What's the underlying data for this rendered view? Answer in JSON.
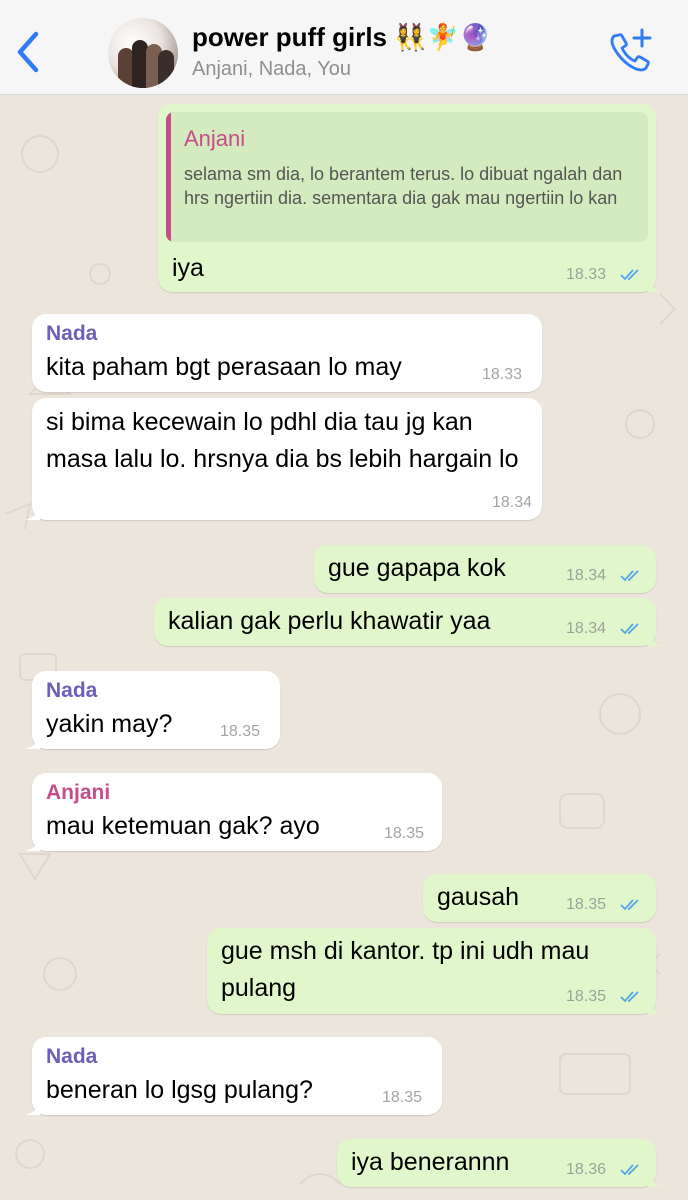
{
  "header": {
    "title": "power puff girls 👯‍♀️🧚🔮",
    "subtitle": "Anjani, Nada, You",
    "back_icon": "chevron-left-icon",
    "call_icon": "add-call-icon"
  },
  "colors": {
    "outgoing_bubble": "#e1f7cb",
    "incoming_bubble": "#ffffff",
    "nada_name": "#6c5fb7",
    "anjani_name": "#c84b8a",
    "read_ticks": "#53a6e8",
    "accent": "#2f7cf6"
  },
  "messages": [
    {
      "direction": "out",
      "quote": {
        "sender": "Anjani",
        "text": "selama sm dia, lo berantem terus. lo dibuat ngalah dan hrs ngertiin dia. sementara dia gak mau ngertiin lo kan"
      },
      "text": "iya",
      "time": "18.33",
      "status": "read"
    },
    {
      "direction": "in",
      "sender": "Nada",
      "text": "kita paham bgt perasaan lo may",
      "time": "18.33"
    },
    {
      "direction": "in",
      "text": "si bima kecewain lo pdhl dia tau jg kan masa lalu lo. hrsnya dia bs lebih hargain lo",
      "time": "18.34"
    },
    {
      "direction": "out",
      "text": "gue gapapa kok",
      "time": "18.34",
      "status": "read"
    },
    {
      "direction": "out",
      "text": "kalian gak perlu khawatir yaa",
      "time": "18.34",
      "status": "read"
    },
    {
      "direction": "in",
      "sender": "Nada",
      "text": "yakin may?",
      "time": "18.35"
    },
    {
      "direction": "in",
      "sender": "Anjani",
      "text": "mau ketemuan gak? ayo",
      "time": "18.35"
    },
    {
      "direction": "out",
      "text": "gausah",
      "time": "18.35",
      "status": "read"
    },
    {
      "direction": "out",
      "text": "gue msh di kantor. tp ini udh mau pulang",
      "time": "18.35",
      "status": "read"
    },
    {
      "direction": "in",
      "sender": "Nada",
      "text": "beneran lo lgsg pulang?",
      "time": "18.35"
    },
    {
      "direction": "out",
      "text": "iya benerannn",
      "time": "18.36",
      "status": "read"
    }
  ]
}
